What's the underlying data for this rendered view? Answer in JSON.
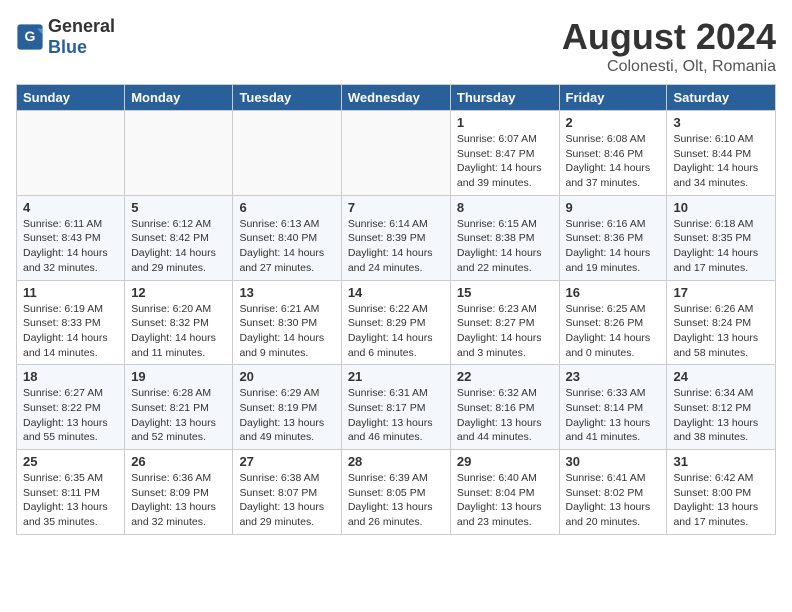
{
  "header": {
    "logo_general": "General",
    "logo_blue": "Blue",
    "month_year": "August 2024",
    "location": "Colonesti, Olt, Romania"
  },
  "weekdays": [
    "Sunday",
    "Monday",
    "Tuesday",
    "Wednesday",
    "Thursday",
    "Friday",
    "Saturday"
  ],
  "weeks": [
    [
      {
        "day": "",
        "info": ""
      },
      {
        "day": "",
        "info": ""
      },
      {
        "day": "",
        "info": ""
      },
      {
        "day": "",
        "info": ""
      },
      {
        "day": "1",
        "info": "Sunrise: 6:07 AM\nSunset: 8:47 PM\nDaylight: 14 hours\nand 39 minutes."
      },
      {
        "day": "2",
        "info": "Sunrise: 6:08 AM\nSunset: 8:46 PM\nDaylight: 14 hours\nand 37 minutes."
      },
      {
        "day": "3",
        "info": "Sunrise: 6:10 AM\nSunset: 8:44 PM\nDaylight: 14 hours\nand 34 minutes."
      }
    ],
    [
      {
        "day": "4",
        "info": "Sunrise: 6:11 AM\nSunset: 8:43 PM\nDaylight: 14 hours\nand 32 minutes."
      },
      {
        "day": "5",
        "info": "Sunrise: 6:12 AM\nSunset: 8:42 PM\nDaylight: 14 hours\nand 29 minutes."
      },
      {
        "day": "6",
        "info": "Sunrise: 6:13 AM\nSunset: 8:40 PM\nDaylight: 14 hours\nand 27 minutes."
      },
      {
        "day": "7",
        "info": "Sunrise: 6:14 AM\nSunset: 8:39 PM\nDaylight: 14 hours\nand 24 minutes."
      },
      {
        "day": "8",
        "info": "Sunrise: 6:15 AM\nSunset: 8:38 PM\nDaylight: 14 hours\nand 22 minutes."
      },
      {
        "day": "9",
        "info": "Sunrise: 6:16 AM\nSunset: 8:36 PM\nDaylight: 14 hours\nand 19 minutes."
      },
      {
        "day": "10",
        "info": "Sunrise: 6:18 AM\nSunset: 8:35 PM\nDaylight: 14 hours\nand 17 minutes."
      }
    ],
    [
      {
        "day": "11",
        "info": "Sunrise: 6:19 AM\nSunset: 8:33 PM\nDaylight: 14 hours\nand 14 minutes."
      },
      {
        "day": "12",
        "info": "Sunrise: 6:20 AM\nSunset: 8:32 PM\nDaylight: 14 hours\nand 11 minutes."
      },
      {
        "day": "13",
        "info": "Sunrise: 6:21 AM\nSunset: 8:30 PM\nDaylight: 14 hours\nand 9 minutes."
      },
      {
        "day": "14",
        "info": "Sunrise: 6:22 AM\nSunset: 8:29 PM\nDaylight: 14 hours\nand 6 minutes."
      },
      {
        "day": "15",
        "info": "Sunrise: 6:23 AM\nSunset: 8:27 PM\nDaylight: 14 hours\nand 3 minutes."
      },
      {
        "day": "16",
        "info": "Sunrise: 6:25 AM\nSunset: 8:26 PM\nDaylight: 14 hours\nand 0 minutes."
      },
      {
        "day": "17",
        "info": "Sunrise: 6:26 AM\nSunset: 8:24 PM\nDaylight: 13 hours\nand 58 minutes."
      }
    ],
    [
      {
        "day": "18",
        "info": "Sunrise: 6:27 AM\nSunset: 8:22 PM\nDaylight: 13 hours\nand 55 minutes."
      },
      {
        "day": "19",
        "info": "Sunrise: 6:28 AM\nSunset: 8:21 PM\nDaylight: 13 hours\nand 52 minutes."
      },
      {
        "day": "20",
        "info": "Sunrise: 6:29 AM\nSunset: 8:19 PM\nDaylight: 13 hours\nand 49 minutes."
      },
      {
        "day": "21",
        "info": "Sunrise: 6:31 AM\nSunset: 8:17 PM\nDaylight: 13 hours\nand 46 minutes."
      },
      {
        "day": "22",
        "info": "Sunrise: 6:32 AM\nSunset: 8:16 PM\nDaylight: 13 hours\nand 44 minutes."
      },
      {
        "day": "23",
        "info": "Sunrise: 6:33 AM\nSunset: 8:14 PM\nDaylight: 13 hours\nand 41 minutes."
      },
      {
        "day": "24",
        "info": "Sunrise: 6:34 AM\nSunset: 8:12 PM\nDaylight: 13 hours\nand 38 minutes."
      }
    ],
    [
      {
        "day": "25",
        "info": "Sunrise: 6:35 AM\nSunset: 8:11 PM\nDaylight: 13 hours\nand 35 minutes."
      },
      {
        "day": "26",
        "info": "Sunrise: 6:36 AM\nSunset: 8:09 PM\nDaylight: 13 hours\nand 32 minutes."
      },
      {
        "day": "27",
        "info": "Sunrise: 6:38 AM\nSunset: 8:07 PM\nDaylight: 13 hours\nand 29 minutes."
      },
      {
        "day": "28",
        "info": "Sunrise: 6:39 AM\nSunset: 8:05 PM\nDaylight: 13 hours\nand 26 minutes."
      },
      {
        "day": "29",
        "info": "Sunrise: 6:40 AM\nSunset: 8:04 PM\nDaylight: 13 hours\nand 23 minutes."
      },
      {
        "day": "30",
        "info": "Sunrise: 6:41 AM\nSunset: 8:02 PM\nDaylight: 13 hours\nand 20 minutes."
      },
      {
        "day": "31",
        "info": "Sunrise: 6:42 AM\nSunset: 8:00 PM\nDaylight: 13 hours\nand 17 minutes."
      }
    ]
  ]
}
